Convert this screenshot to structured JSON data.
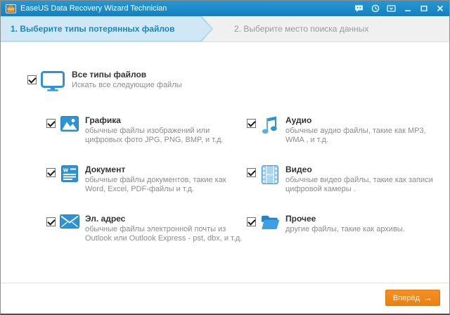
{
  "colors": {
    "titlebar_blue": "#1787c7",
    "accent_blue": "#2e93d6",
    "step_active_bg": "#d0e8f6",
    "step_active_text": "#1b84c4",
    "step_inactive_text": "#9a9a9a",
    "button_orange": "#ef8519"
  },
  "window": {
    "title": "EaseUS Data Recovery Wizard Technician"
  },
  "steps": [
    {
      "label": "1. Выберите типы потерянных файлов",
      "active": true
    },
    {
      "label": "2. Выберите место поиска данных",
      "active": false
    }
  ],
  "all_types": {
    "title": "Все типы файлов",
    "description": "Искать все следующие файлы",
    "checked": true
  },
  "file_types": [
    {
      "title": "Графика",
      "description": "обычные файлы изображений или цифровых фото JPG, PNG, BMP, и т.д.",
      "icon": "image-icon",
      "checked": true
    },
    {
      "title": "Аудио",
      "description": "обычные аудио файлы, такие как MP3, WMA , и т.д.",
      "icon": "music-note-icon",
      "checked": true
    },
    {
      "title": "Документ",
      "description": "обычные файлы документов, такие как Word, Excel, PDF-файлы и т.д.",
      "icon": "document-icon",
      "checked": true
    },
    {
      "title": "Видео",
      "description": "обычные видео файлы, такие как записи цифровой камеры .",
      "icon": "film-icon",
      "checked": true
    },
    {
      "title": "Эл. адрес",
      "description": "обычные файлы электронной почты из Outlook или Outlook Express - pst, dbx, и т.д.",
      "icon": "envelope-icon",
      "checked": true
    },
    {
      "title": "Прочее",
      "description": "другие файлы, такие как архивы.",
      "icon": "folder-icon",
      "checked": true
    }
  ],
  "icons": {
    "document_letter": "w"
  },
  "footer": {
    "next_label": "Вперёд",
    "next_arrow": "→"
  }
}
